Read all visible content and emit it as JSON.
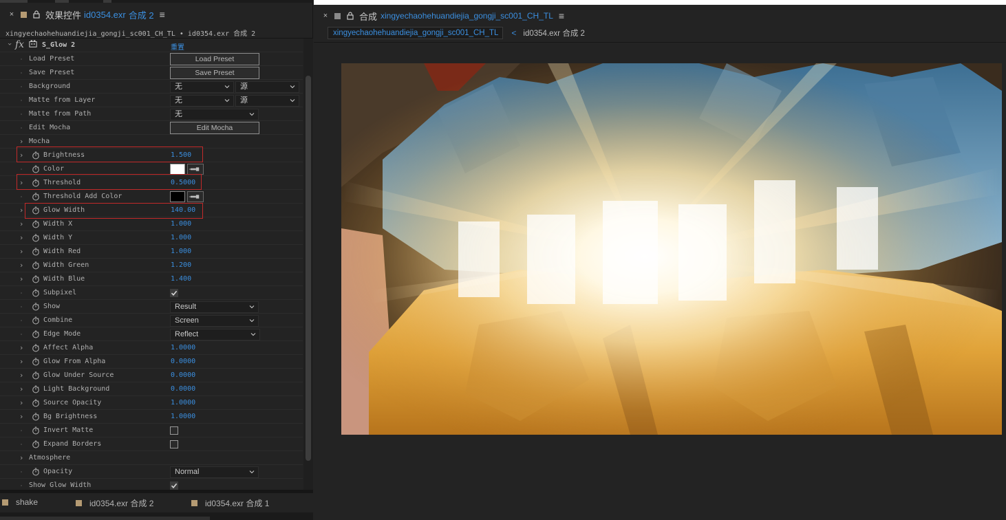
{
  "effect_controls": {
    "close": "×",
    "title_prefix": "效果控件",
    "title_layer": "id0354.exr",
    "title_comp": "合成 2",
    "menu": "≡",
    "subtitle": "xingyechaohehuandiejia_gongji_sc001_CH_TL • id0354.exr 合成 2",
    "fx_glyph": "fx",
    "effect_name": "S_Glow 2",
    "reset": "重置",
    "rows": {
      "load_preset": {
        "label": "Load Preset",
        "button": "Load Preset"
      },
      "save_preset": {
        "label": "Save Preset",
        "button": "Save Preset"
      },
      "background": {
        "label": "Background",
        "sel1": "无",
        "sel2": "源"
      },
      "matte_from_layer": {
        "label": "Matte from Layer",
        "sel1": "无",
        "sel2": "源"
      },
      "matte_from_path": {
        "label": "Matte from Path",
        "sel1": "无"
      },
      "edit_mocha": {
        "label": "Edit Mocha",
        "button": "Edit Mocha"
      },
      "mocha": {
        "label": "Mocha"
      },
      "brightness": {
        "label": "Brightness",
        "value": "1.500"
      },
      "color": {
        "label": "Color",
        "swatch": "#ffffff"
      },
      "threshold": {
        "label": "Threshold",
        "value": "0.5000"
      },
      "threshold_add_color": {
        "label": "Threshold Add Color",
        "swatch": "#000000"
      },
      "glow_width": {
        "label": "Glow Width",
        "value": "140.00"
      },
      "width_x": {
        "label": "Width X",
        "value": "1.000"
      },
      "width_y": {
        "label": "Width Y",
        "value": "1.000"
      },
      "width_red": {
        "label": "Width Red",
        "value": "1.000"
      },
      "width_green": {
        "label": "Width Green",
        "value": "1.200"
      },
      "width_blue": {
        "label": "Width Blue",
        "value": "1.400"
      },
      "subpixel": {
        "label": "Subpixel",
        "checked": true
      },
      "show": {
        "label": "Show",
        "sel": "Result"
      },
      "combine": {
        "label": "Combine",
        "sel": "Screen"
      },
      "edge_mode": {
        "label": "Edge Mode",
        "sel": "Reflect"
      },
      "affect_alpha": {
        "label": "Affect Alpha",
        "value": "1.0000"
      },
      "glow_from_alpha": {
        "label": "Glow From Alpha",
        "value": "0.0000"
      },
      "glow_under_source": {
        "label": "Glow Under Source",
        "value": "0.0000"
      },
      "light_background": {
        "label": "Light Background",
        "value": "0.0000"
      },
      "source_opacity": {
        "label": "Source Opacity",
        "value": "1.0000"
      },
      "bg_brightness": {
        "label": "Bg Brightness",
        "value": "1.0000"
      },
      "invert_matte": {
        "label": "Invert Matte",
        "checked": false
      },
      "expand_borders": {
        "label": "Expand Borders",
        "checked": false
      },
      "atmosphere": {
        "label": "Atmosphere"
      },
      "opacity": {
        "label": "Opacity",
        "sel": "Normal"
      },
      "show_glow_width": {
        "label": "Show Glow Width",
        "checked": true
      }
    }
  },
  "timeline_tabs": [
    {
      "label": "shake",
      "color": "#b59b73"
    },
    {
      "label": "id0354.exr 合成 2",
      "color": "#b59b73"
    },
    {
      "label": "id0354.exr 合成 1",
      "color": "#b59b73"
    }
  ],
  "composition": {
    "close": "×",
    "title_prefix": "合成",
    "title_comp": "xingyechaohehuandiejia_gongji_sc001_CH_TL",
    "menu": "≡",
    "tabs": {
      "active": "xingyechaohehuandiejia_gongji_sc001_CH_TL",
      "chevron": "<",
      "other": "id0354.exr 合成 2"
    }
  },
  "colors": {
    "accent_blue": "#3b8fe0",
    "highlight_red": "#c32a2a",
    "label_tag": "#b59b73"
  },
  "icons": {
    "stopwatch": "stopwatch-icon",
    "twirl": "chevron-right-icon",
    "dropdown": "chevron-down-icon",
    "eyedropper": "eyedropper-icon",
    "lock": "lock-icon"
  }
}
